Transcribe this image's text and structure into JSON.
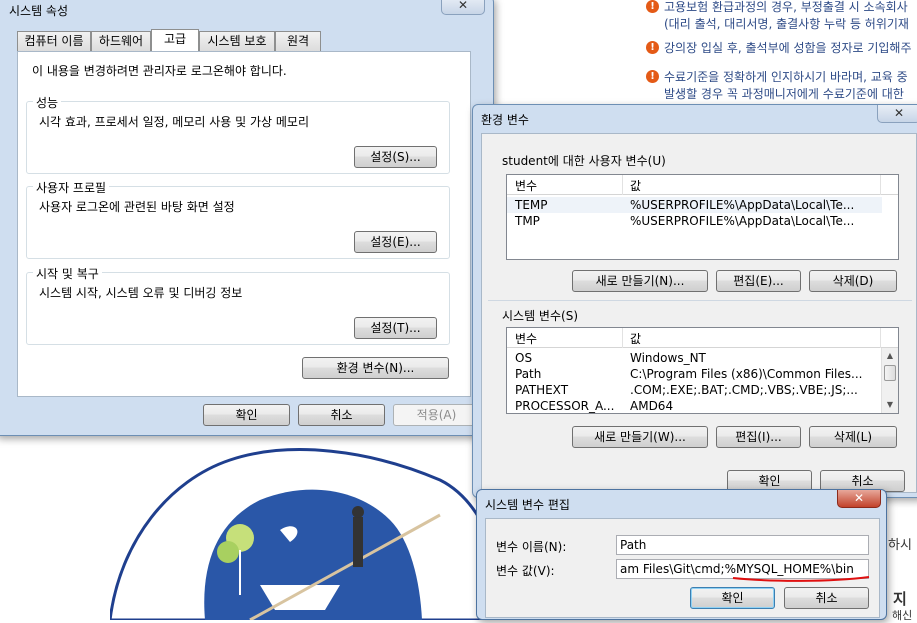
{
  "background": {
    "notices": [
      "고용보험 환급과정의 경우, 부정출결 시 소속회사",
      "(대리 출석, 대리서명, 출결사항 누락 등 허위기재",
      "강의장 입실 후, 출석부에 성함을 정자로 기입해주",
      "수료기준을 정확하게 인지하시기 바라며, 교육 중",
      "발생할 경우 꼭 과정매니저에게 수료기준에 대한"
    ],
    "side_text_1": "하시",
    "side_text_2": "지",
    "side_text_3": "해신"
  },
  "system_props": {
    "title": "시스템 속성",
    "close": "✕",
    "tabs": [
      "컴퓨터 이름",
      "하드웨어",
      "고급",
      "시스템 보호",
      "원격"
    ],
    "admin_note": "이 내용을 변경하려면 관리자로 로그온해야 합니다.",
    "performance": {
      "label": "성능",
      "desc": "시각 효과, 프로세서 일정, 메모리 사용 및 가상 메모리",
      "button": "설정(S)..."
    },
    "profile": {
      "label": "사용자 프로필",
      "desc": "사용자 로그온에 관련된 바탕 화면 설정",
      "button": "설정(E)..."
    },
    "startup": {
      "label": "시작 및 복구",
      "desc": "시스템 시작, 시스템 오류 및 디버깅 정보",
      "button": "설정(T)..."
    },
    "env_button": "환경 변수(N)...",
    "ok": "확인",
    "cancel": "취소",
    "apply": "적용(A)"
  },
  "env_vars": {
    "title": "환경 변수",
    "close": "✕",
    "user_section": "student에 대한 사용자 변수(U)",
    "col_var": "변수",
    "col_val": "값",
    "user_rows": [
      {
        "name": "TEMP",
        "value": "%USERPROFILE%\\AppData\\Local\\Te..."
      },
      {
        "name": "TMP",
        "value": "%USERPROFILE%\\AppData\\Local\\Te..."
      }
    ],
    "user_new": "새로 만들기(N)...",
    "user_edit": "편집(E)...",
    "user_delete": "삭제(D)",
    "sys_section": "시스템 변수(S)",
    "sys_rows": [
      {
        "name": "OS",
        "value": "Windows_NT"
      },
      {
        "name": "Path",
        "value": "C:\\Program Files (x86)\\Common Files..."
      },
      {
        "name": "PATHEXT",
        "value": ".COM;.EXE;.BAT;.CMD;.VBS;.VBE;.JS;..."
      },
      {
        "name": "PROCESSOR_A...",
        "value": "AMD64"
      }
    ],
    "sys_new": "새로 만들기(W)...",
    "sys_edit": "편집(I)...",
    "sys_delete": "삭제(L)",
    "ok": "확인",
    "cancel": "취소"
  },
  "edit_var": {
    "title": "시스템 변수 편집",
    "close": "✕",
    "name_label": "변수 이름(N):",
    "name_value": "Path",
    "value_label": "변수 값(V):",
    "value_prefix": "am Files\\Git\\cmd;",
    "value_highlight": "%MYSQL_HOME%\\bin",
    "ok": "확인",
    "cancel": "취소"
  },
  "colors": {
    "window_frame": "#cfdef0",
    "accent_underline": "#e01010",
    "notice_text": "#2d4a86",
    "notice_icon": "#e45a16"
  }
}
